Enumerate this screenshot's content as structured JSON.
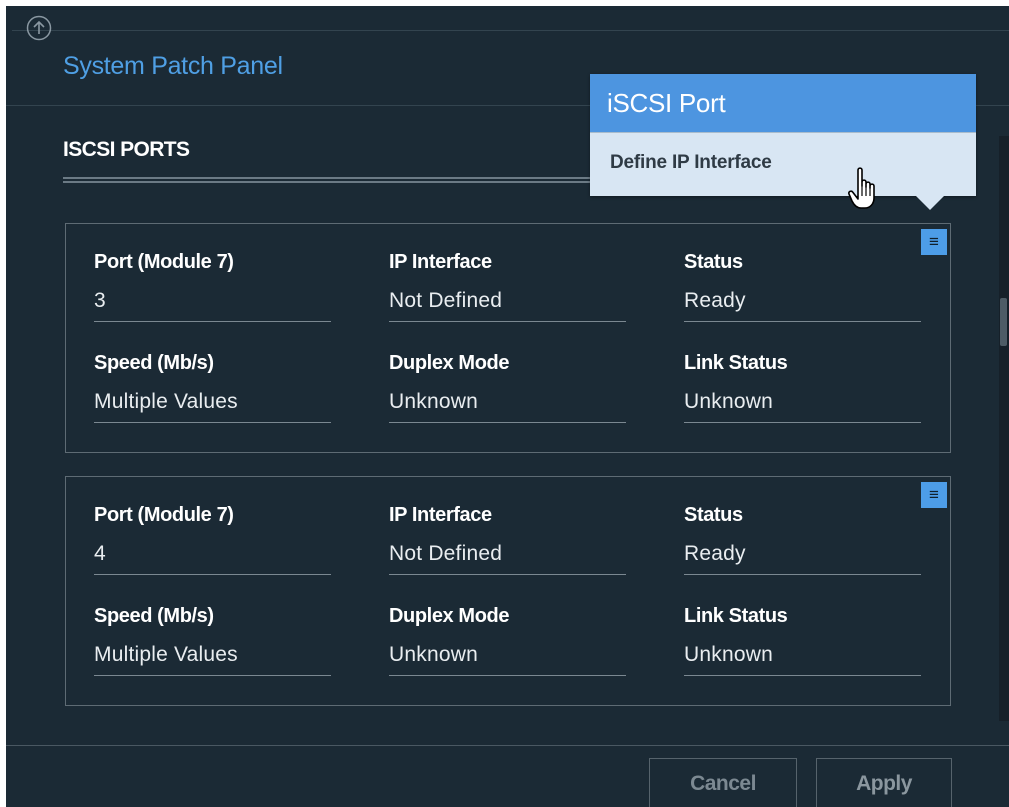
{
  "header": {
    "title": "System Patch Panel",
    "up_icon": "arrow-up-circle-icon"
  },
  "section": {
    "title": "ISCSI PORTS"
  },
  "cards": [
    {
      "menu_icon": "hamburger-menu-icon",
      "fields": [
        {
          "label": "Port (Module 7)",
          "value": "3"
        },
        {
          "label": "IP Interface",
          "value": "Not Defined"
        },
        {
          "label": "Status",
          "value": "Ready"
        },
        {
          "label": "Speed (Mb/s)",
          "value": "Multiple Values"
        },
        {
          "label": "Duplex Mode",
          "value": "Unknown"
        },
        {
          "label": "Link Status",
          "value": "Unknown"
        }
      ]
    },
    {
      "menu_icon": "hamburger-menu-icon",
      "fields": [
        {
          "label": "Port (Module 7)",
          "value": "4"
        },
        {
          "label": "IP Interface",
          "value": "Not Defined"
        },
        {
          "label": "Status",
          "value": "Ready"
        },
        {
          "label": "Speed (Mb/s)",
          "value": "Multiple Values"
        },
        {
          "label": "Duplex Mode",
          "value": "Unknown"
        },
        {
          "label": "Link Status",
          "value": "Unknown"
        }
      ]
    }
  ],
  "popup": {
    "title": "iSCSI Port",
    "items": [
      {
        "label": "Define IP Interface"
      }
    ]
  },
  "footer": {
    "cancel_label": "Cancel",
    "apply_label": "Apply"
  },
  "colors": {
    "background": "#1b2a35",
    "accent": "#4d95e0",
    "title_blue": "#4f9fe4",
    "popup_bg": "#d8e6f3"
  }
}
